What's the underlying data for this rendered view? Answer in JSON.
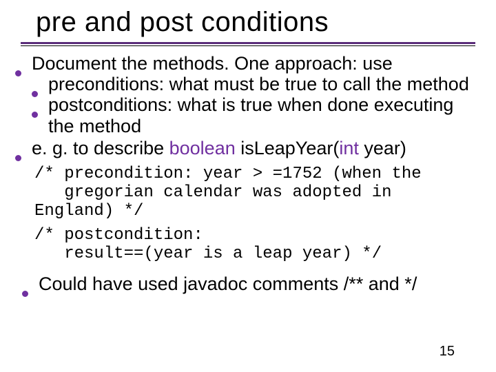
{
  "title": "pre and post conditions",
  "bullets": {
    "b1": "Document the methods. One approach: use",
    "b1a": "preconditions: what must be true to call the method",
    "b1b": "postconditions: what is true when done executing the method",
    "b2_prefix": "e. g. to describe ",
    "b2_kw1": "boolean",
    "b2_mid": " isLeapYear(",
    "b2_kw2": "int",
    "b2_suffix": " year)",
    "b3": "Could have used javadoc comments /** and */"
  },
  "code": {
    "pre": "/* precondition: year > =1752 (when the\n   gregorian calendar was adopted in England) */",
    "post": "/* postcondition:\n   result==(year is a leap year) */"
  },
  "pagenum": "15"
}
